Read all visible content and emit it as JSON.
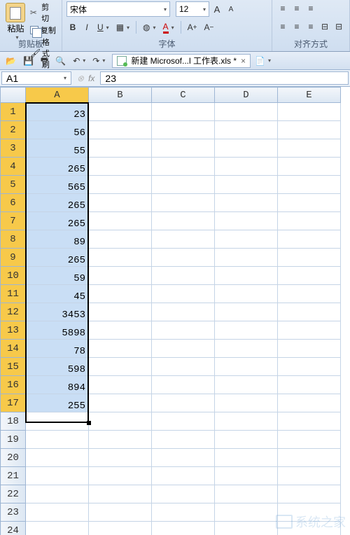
{
  "ribbon": {
    "clipboard": {
      "paste_label": "粘贴",
      "cut_label": "剪切",
      "copy_label": "复制",
      "format_painter_label": "格式刷",
      "group_label": "剪贴板"
    },
    "font": {
      "name": "宋体",
      "size": "12",
      "group_label": "字体"
    },
    "align": {
      "group_label": "对齐方式"
    }
  },
  "tab": {
    "title": "新建 Microsof...l 工作表.xls *"
  },
  "formula": {
    "cell_ref": "A1",
    "fx_label": "fx",
    "value": "23"
  },
  "columns": [
    "A",
    "B",
    "C",
    "D",
    "E"
  ],
  "rows": [
    {
      "n": 1,
      "a": "23"
    },
    {
      "n": 2,
      "a": "56"
    },
    {
      "n": 3,
      "a": "55"
    },
    {
      "n": 4,
      "a": "265"
    },
    {
      "n": 5,
      "a": "565"
    },
    {
      "n": 6,
      "a": "265"
    },
    {
      "n": 7,
      "a": "265"
    },
    {
      "n": 8,
      "a": "89"
    },
    {
      "n": 9,
      "a": "265"
    },
    {
      "n": 10,
      "a": "59"
    },
    {
      "n": 11,
      "a": "45"
    },
    {
      "n": 12,
      "a": "3453"
    },
    {
      "n": 13,
      "a": "5898"
    },
    {
      "n": 14,
      "a": "78"
    },
    {
      "n": 15,
      "a": "598"
    },
    {
      "n": 16,
      "a": "894"
    },
    {
      "n": 17,
      "a": "255"
    },
    {
      "n": 18,
      "a": ""
    },
    {
      "n": 19,
      "a": ""
    },
    {
      "n": 20,
      "a": ""
    },
    {
      "n": 21,
      "a": ""
    },
    {
      "n": 22,
      "a": ""
    },
    {
      "n": 23,
      "a": ""
    },
    {
      "n": 24,
      "a": ""
    }
  ],
  "selection": {
    "col": "A",
    "row_start": 1,
    "row_end": 17
  },
  "watermark": "系统之家"
}
